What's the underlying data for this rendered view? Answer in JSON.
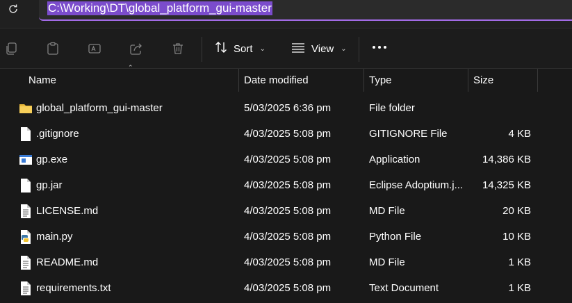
{
  "address_bar": {
    "path": "C:\\Working\\DT\\global_platform_gui-master",
    "refresh_icon": "refresh-icon"
  },
  "toolbar": {
    "icons": [
      "copy-icon",
      "paste-icon",
      "rename-icon",
      "share-icon",
      "delete-icon"
    ],
    "sort_label": "Sort",
    "view_label": "View",
    "more_icon": "more-icon"
  },
  "columns": {
    "name": "Name",
    "date": "Date modified",
    "type": "Type",
    "size": "Size"
  },
  "files": [
    {
      "icon": "folder-icon",
      "name": "global_platform_gui-master",
      "date": "5/03/2025 6:36 pm",
      "type": "File folder",
      "size": ""
    },
    {
      "icon": "file-icon",
      "name": ".gitignore",
      "date": "4/03/2025 5:08 pm",
      "type": "GITIGNORE File",
      "size": "4 KB"
    },
    {
      "icon": "application-icon",
      "name": "gp.exe",
      "date": "4/03/2025 5:08 pm",
      "type": "Application",
      "size": "14,386 KB"
    },
    {
      "icon": "file-icon",
      "name": "gp.jar",
      "date": "4/03/2025 5:08 pm",
      "type": "Eclipse Adoptium.j...",
      "size": "14,325 KB"
    },
    {
      "icon": "text-file-icon",
      "name": "LICENSE.md",
      "date": "4/03/2025 5:08 pm",
      "type": "MD File",
      "size": "20 KB"
    },
    {
      "icon": "python-icon",
      "name": "main.py",
      "date": "4/03/2025 5:08 pm",
      "type": "Python File",
      "size": "10 KB"
    },
    {
      "icon": "text-file-icon",
      "name": "README.md",
      "date": "4/03/2025 5:08 pm",
      "type": "MD File",
      "size": "1 KB"
    },
    {
      "icon": "text-file-icon",
      "name": "requirements.txt",
      "date": "4/03/2025 5:08 pm",
      "type": "Text Document",
      "size": "1 KB"
    }
  ],
  "colors": {
    "accent": "#a26be6",
    "selection": "#7b4ccc",
    "background": "#191919"
  }
}
